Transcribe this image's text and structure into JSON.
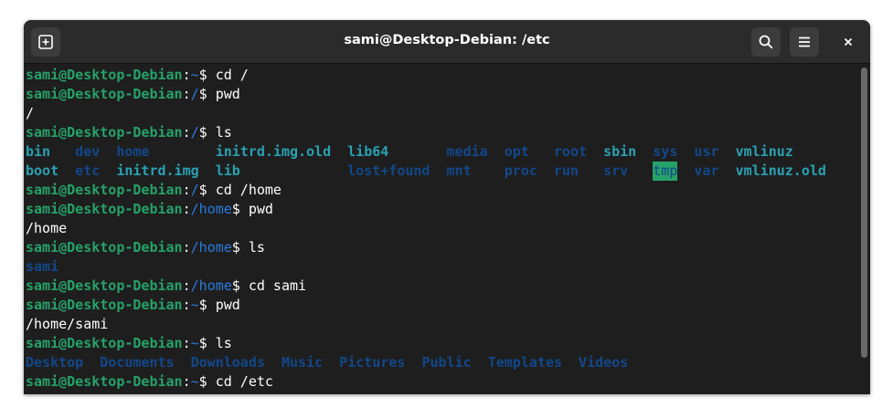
{
  "window": {
    "title": "sami@Desktop-Debian: /etc"
  },
  "icons": {
    "new_tab": "new-tab-icon",
    "search": "search-icon",
    "menu": "hamburger-menu-icon",
    "close": "close-icon"
  },
  "colors": {
    "user": "#26a269",
    "path": "#2a7bde",
    "dir": "#12488b",
    "link": "#2aa1b3",
    "bg": "#1e1e1e"
  },
  "prompt": {
    "user": "sami@Desktop-Debian",
    "colon": ":",
    "dollar": "$"
  },
  "lines": [
    {
      "path": "~",
      "cmd": " cd /"
    },
    {
      "path": "/",
      "cmd": " pwd"
    },
    {
      "out": "/"
    },
    {
      "path": "/",
      "cmd": " ls"
    },
    {
      "ls1": [
        "bin",
        "dev",
        "home",
        "initrd.img.old",
        "lib64",
        "media",
        "opt",
        "root",
        "sbin",
        "sys",
        "usr",
        "vmlinuz"
      ]
    },
    {
      "ls2": [
        "boot",
        "etc",
        "initrd.img",
        "lib",
        "lost+found",
        "mnt",
        "proc",
        "run",
        "srv",
        "tmp",
        "var",
        "vmlinuz.old"
      ]
    },
    {
      "path": "/",
      "cmd": " cd /home"
    },
    {
      "path": "/home",
      "cmd": " pwd"
    },
    {
      "out": "/home"
    },
    {
      "path": "/home",
      "cmd": " ls"
    },
    {
      "out": "sami"
    },
    {
      "path": "/home",
      "cmd": " cd sami"
    },
    {
      "path": "~",
      "cmd": " pwd"
    },
    {
      "out": "/home/sami"
    },
    {
      "path": "~",
      "cmd": " ls"
    },
    {
      "out": "Desktop  Documents  Downloads  Music  Pictures  Public  Templates  Videos"
    },
    {
      "path": "~",
      "cmd": " cd /etc"
    }
  ]
}
